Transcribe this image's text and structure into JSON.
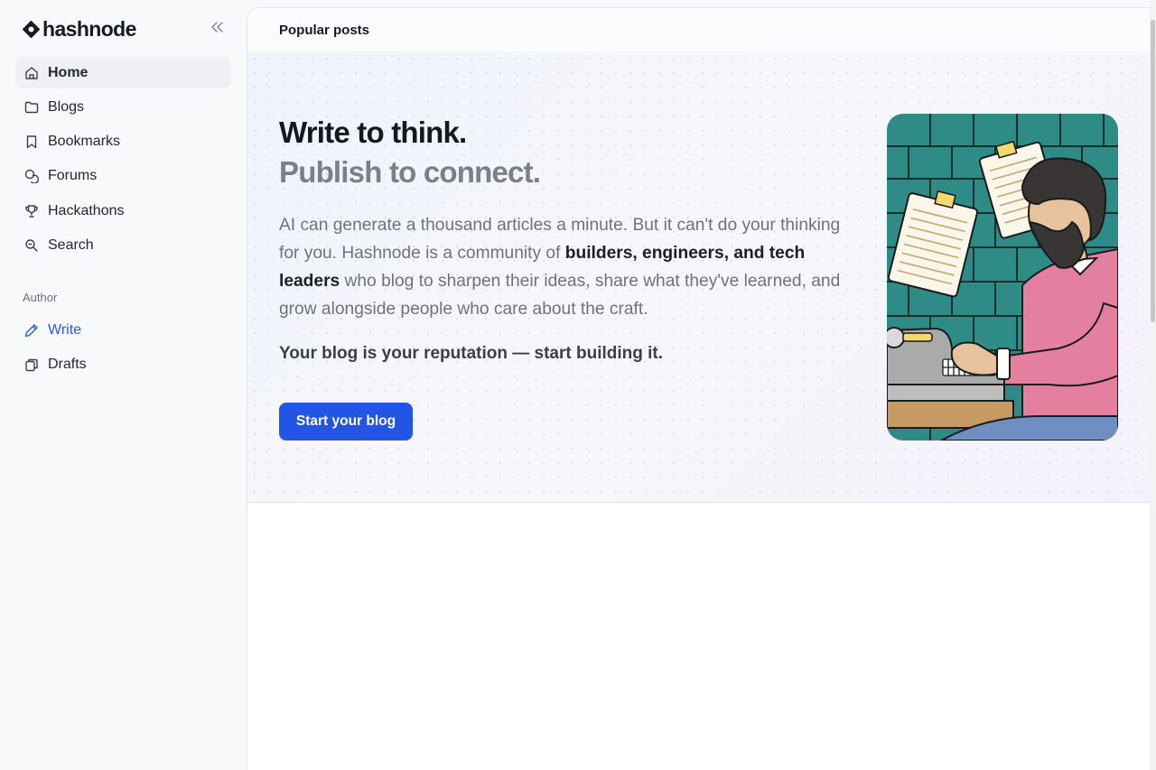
{
  "brand": {
    "name": "hashnode",
    "icon": "hashnode-logo-icon"
  },
  "sidebar": {
    "collapse_icon": "double-chevron-left-icon",
    "items": [
      {
        "label": "Home",
        "icon": "home-icon",
        "active": true
      },
      {
        "label": "Blogs",
        "icon": "folder-icon"
      },
      {
        "label": "Bookmarks",
        "icon": "bookmark-icon"
      },
      {
        "label": "Forums",
        "icon": "forums-icon"
      },
      {
        "label": "Hackathons",
        "icon": "trophy-icon"
      },
      {
        "label": "Search",
        "icon": "search-icon"
      }
    ],
    "section_label": "Author",
    "author_items": [
      {
        "label": "Write",
        "icon": "pen-icon",
        "color": "#2558e8"
      },
      {
        "label": "Drafts",
        "icon": "drafts-icon"
      }
    ]
  },
  "main": {
    "header": "Popular posts",
    "hero": {
      "title": "Write to think.",
      "subtitle": "Publish to connect.",
      "body_part1": "AI can generate a thousand articles a minute. But it can't do your thinking for you. Hashnode is a community of ",
      "body_bold": "builders, engineers, and tech leaders",
      "body_part2": " who blog to sharpen their ideas, share what they've learned, and grow alongside people who care about the craft.",
      "tagline": "Your blog is your reputation — start building it.",
      "cta_label": "Start your blog",
      "illustration": "man-at-typewriter-illustration"
    }
  },
  "colors": {
    "accent": "#2255e3",
    "sidebar_bg": "#f8f9fb",
    "illustration_bg": "#2e8b86"
  }
}
